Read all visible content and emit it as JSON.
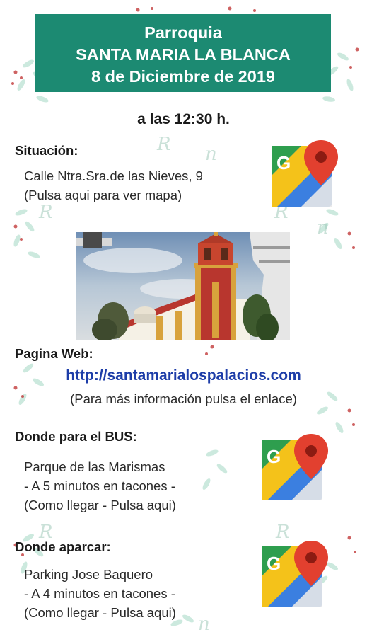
{
  "header": {
    "line1": "Parroquia",
    "line2": "SANTA MARIA LA BLANCA",
    "line3": "8 de Diciembre de 2019"
  },
  "time": "a las 12:30 h.",
  "location": {
    "title": "Situación:",
    "address": "Calle Ntra.Sra.de las Nieves, 9",
    "hint": "(Pulsa aqui para ver mapa)",
    "icon": "google-maps-icon"
  },
  "website": {
    "title": "Pagina Web:",
    "url": "http://santamarialospalacios.com",
    "note": "(Para más información pulsa el enlace)"
  },
  "bus": {
    "title": "Donde para el BUS:",
    "place": "Parque de las Marismas",
    "distance": "- A 5 minutos en tacones -",
    "hint": "(Como llegar - Pulsa aqui)",
    "icon": "google-maps-icon"
  },
  "parking": {
    "title": "Donde aparcar:",
    "place": "Parking Jose Baquero",
    "distance": "- A 4 minutos en tacones -",
    "hint": "(Como llegar - Pulsa aqui)",
    "icon": "google-maps-icon"
  },
  "colors": {
    "header_bg": "#1c8a72",
    "link": "#1d3da8",
    "tower_red": "#b8362e",
    "tower_ochre": "#d8a23c"
  }
}
